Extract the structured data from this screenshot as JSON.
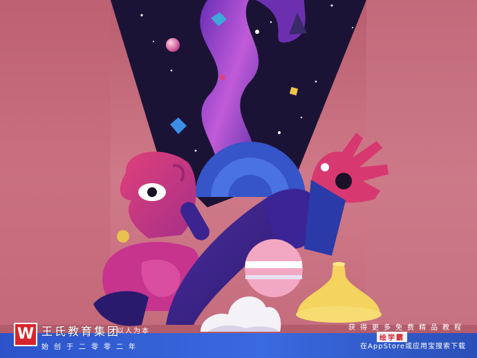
{
  "colors": {
    "background_pink": "#c9707f",
    "night_sky": "#1b1335",
    "brand_blue": "#3a6ae0",
    "logo_red": "#d6262c",
    "figure_magenta": "#c6348e",
    "figure_purple": "#4a2a9a"
  },
  "brand": {
    "logo_letter": "W",
    "name": "王氏教育集团",
    "slogan": "以人为本",
    "founded": "始创于二零零二年"
  },
  "promo": {
    "line1": "获得更多免费精品教程",
    "app_name": "绘学霸",
    "line2": "在AppStore或应用宝搜索下载"
  }
}
